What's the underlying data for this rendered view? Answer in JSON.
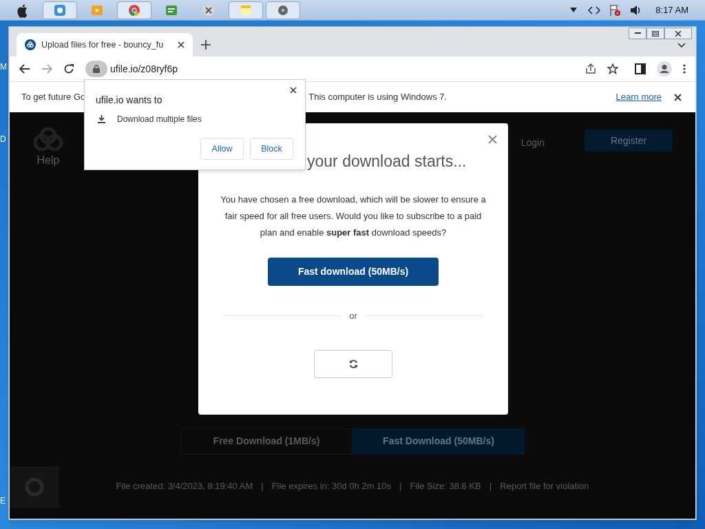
{
  "taskbar": {
    "clock": "8:17 AM"
  },
  "desktop": {
    "edge_labels": [
      "M",
      "D",
      "E"
    ]
  },
  "browser": {
    "tabs": [
      {
        "title": "Upload files for free - bouncy_fu",
        "selected": true
      }
    ],
    "address": "ufile.io/z08ryf6p",
    "infobar": {
      "text_start": "To get future Go",
      "text_end": "This computer is using Windows 7.",
      "link": "Learn more"
    }
  },
  "page": {
    "nav": {
      "help": "Help",
      "login": "Login",
      "register": "Register"
    },
    "buttons": [
      "Free Download (1MB/s)",
      "Fast Download (50MB/s)"
    ],
    "footer": [
      "File created: 3/4/2023, 8:19:40 AM",
      "File expires in: 30d 0h 2m 10s",
      "File Size: 38.6 KB",
      "Report file for violation"
    ],
    "footer_separator": "|"
  },
  "modal": {
    "title": "your download starts...",
    "message": "You have chosen a free download, which will be slower to ensure a fair speed for all free users. Would you like to subscribe to a paid plan and enable **super fast** download speeds?",
    "primary_button": "Fast download (50MB/s)",
    "separator": "or"
  },
  "permission_popup": {
    "heading": "ufile.io wants to",
    "permission": "Download multiple files",
    "buttons": [
      "Allow",
      "Block"
    ]
  }
}
